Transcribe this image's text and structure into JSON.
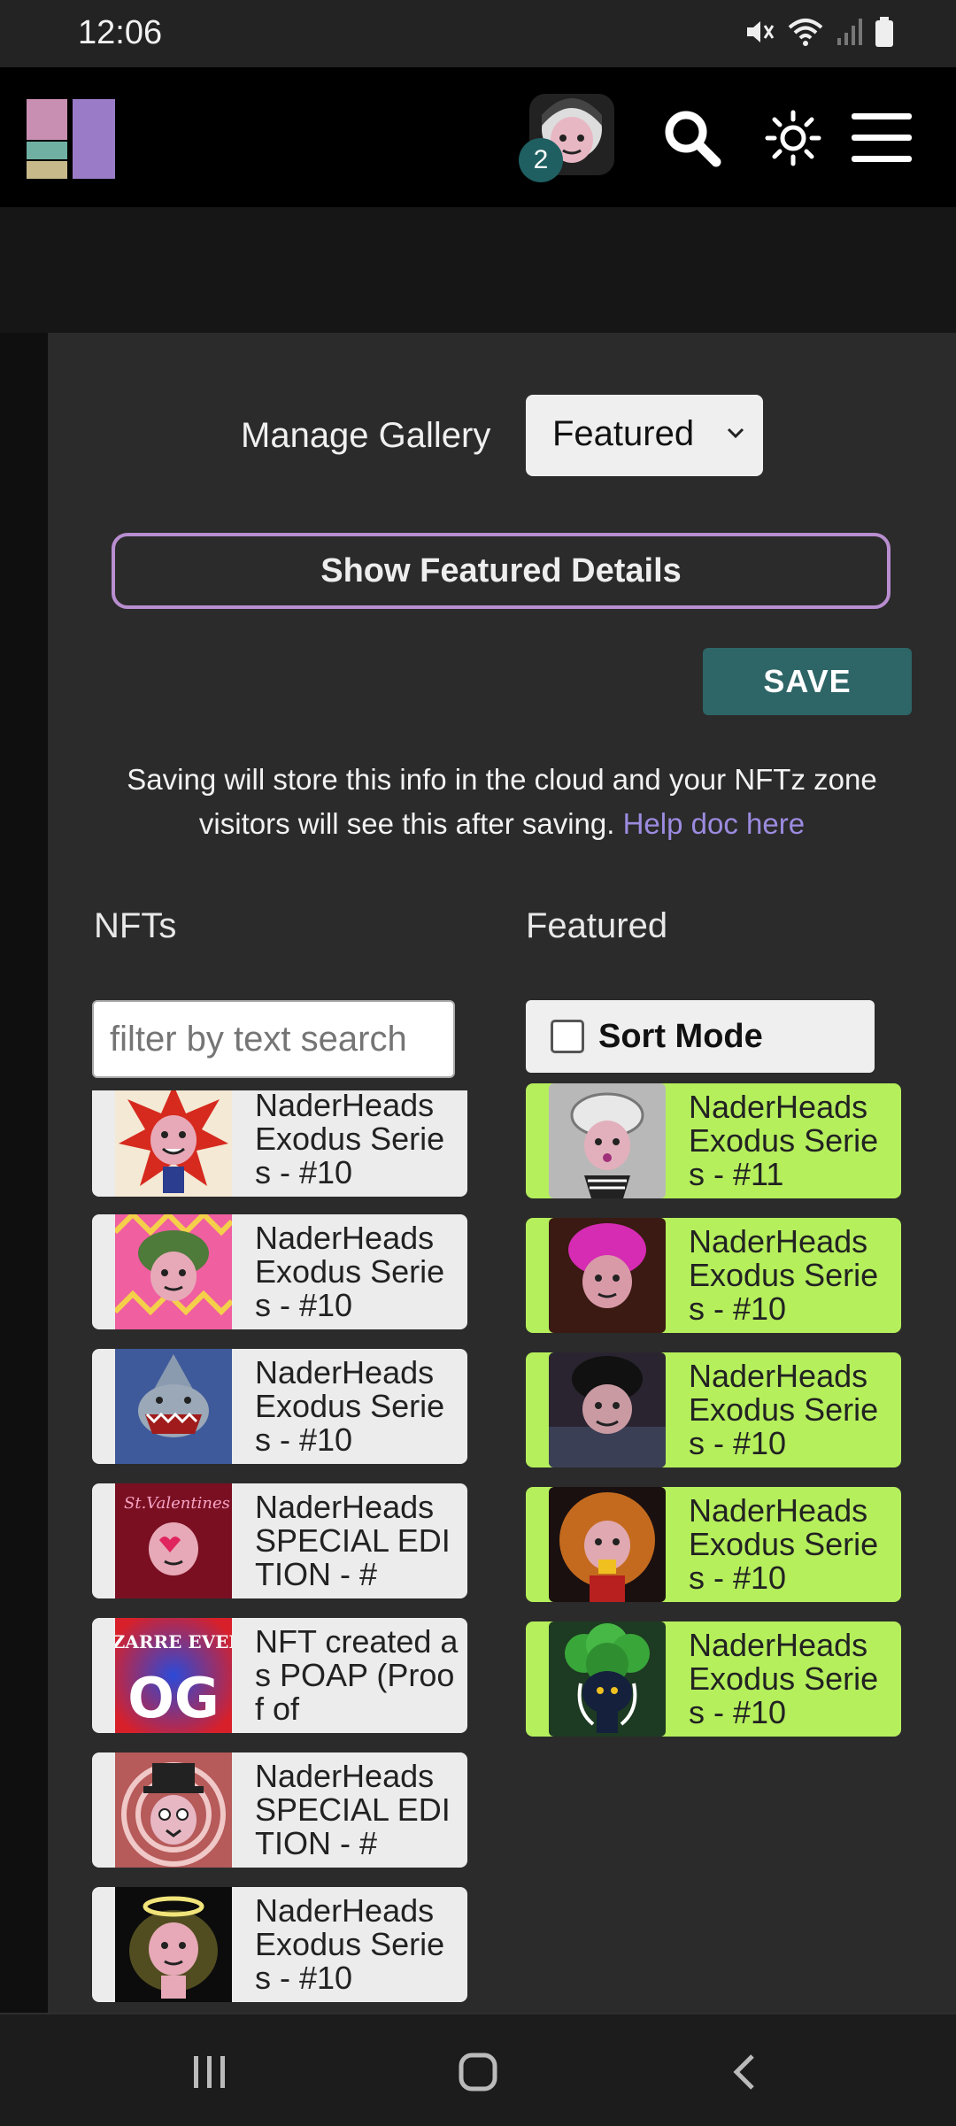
{
  "status": {
    "time": "12:06"
  },
  "header": {
    "notification_count": "2"
  },
  "gallery": {
    "manage_label": "Manage Gallery",
    "select_value": "Featured",
    "featured_details_label": "Show Featured Details",
    "save_label": "SAVE",
    "info_text": "Saving will store this info in the cloud and your NFTz zone visitors will see this after saving.",
    "help_link": "Help doc here"
  },
  "nfts": {
    "title": "NFTs",
    "filter_placeholder": "filter by text search",
    "items": [
      {
        "label": "NaderHeads Exodus Series - #10",
        "thumb": "red-spiky-head"
      },
      {
        "label": "NaderHeads Exodus Series - #10",
        "thumb": "green-hair-zigzag"
      },
      {
        "label": "NaderHeads Exodus Series - #10",
        "thumb": "shark-head"
      },
      {
        "label": "NaderHeads SPECIAL EDITION - #",
        "thumb": "valentines-head"
      },
      {
        "label": "NFT created as POAP (Proof of",
        "thumb": "bizarre-event-og",
        "thumb_title": "BIZARRE EVENT",
        "thumb_big": "OG"
      },
      {
        "label": "NaderHeads SPECIAL EDITION - #",
        "thumb": "top-hat-spiral"
      },
      {
        "label": "NaderHeads Exodus Series - #10",
        "thumb": "halo-head"
      }
    ]
  },
  "featured": {
    "title": "Featured",
    "sort_mode_label": "Sort Mode",
    "items": [
      {
        "label": "NaderHeads Exodus Series - #11",
        "thumb": "gray-crown-head"
      },
      {
        "label": "NaderHeads Exodus Series - #10",
        "thumb": "magenta-hair-head"
      },
      {
        "label": "NaderHeads Exodus Series - #10",
        "thumb": "dark-hood-head"
      },
      {
        "label": "NaderHeads Exodus Series - #10",
        "thumb": "orange-fur-head"
      },
      {
        "label": "NaderHeads Exodus Series - #10",
        "thumb": "broccoli-head"
      }
    ]
  }
}
